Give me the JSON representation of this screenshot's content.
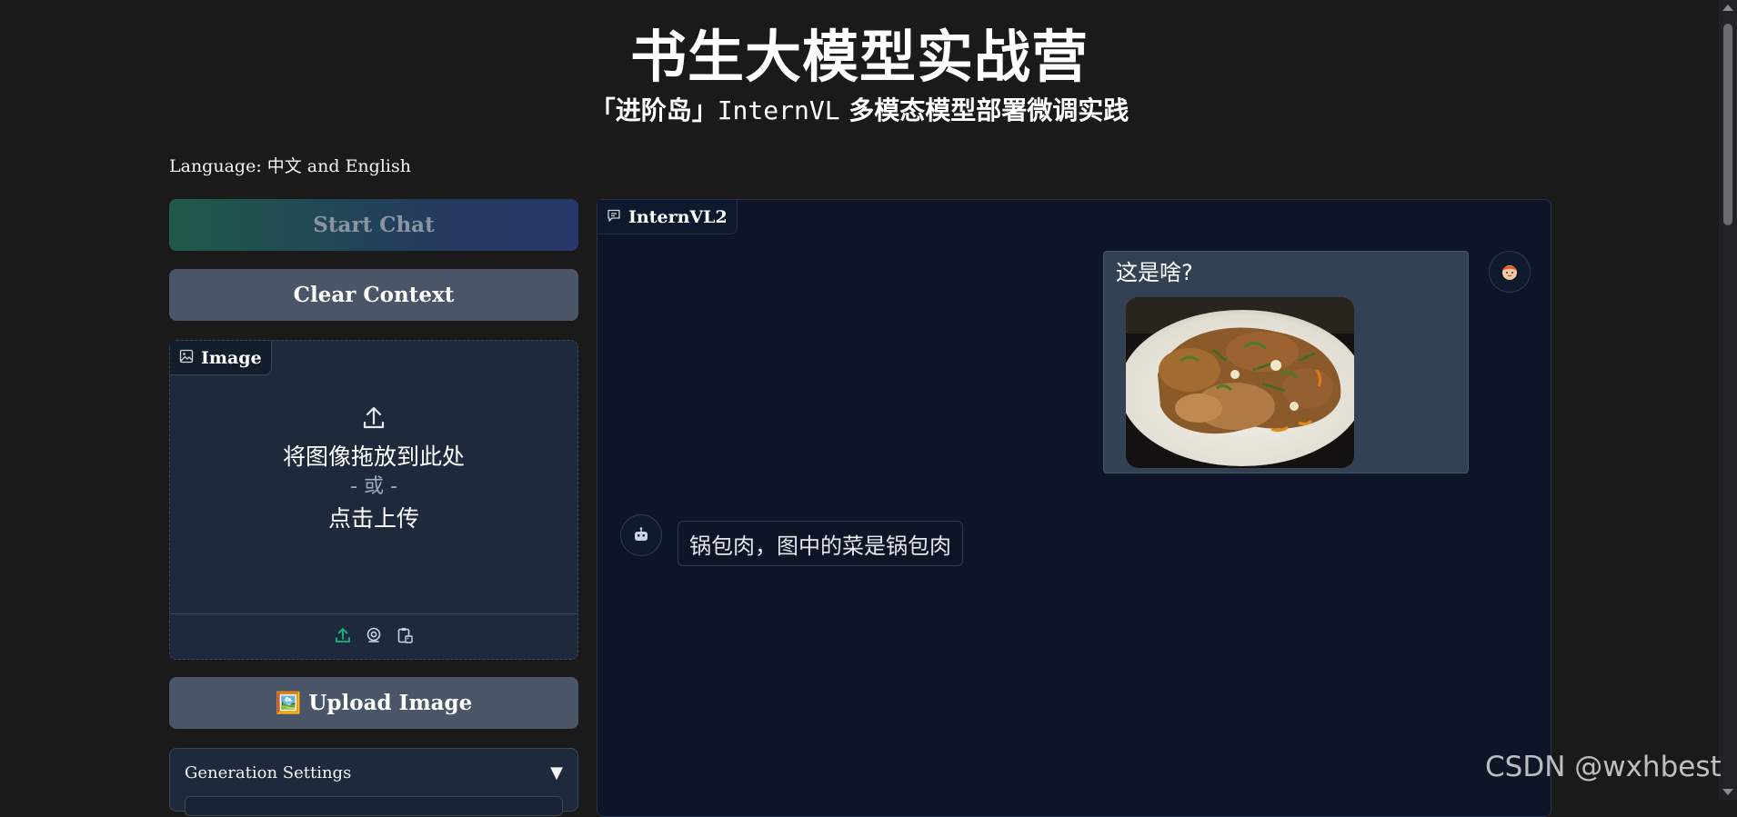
{
  "header": {
    "title": "书生大模型实战营",
    "subtitle_cn_left": "「进阶岛」",
    "subtitle_mono": "InternVL",
    "subtitle_cn_right": " 多模态模型部署微调实践"
  },
  "language_note": "Language: 中文 and English",
  "buttons": {
    "start_chat": "Start Chat",
    "clear_context": "Clear Context",
    "upload_image": "🖼️ Upload Image"
  },
  "image_panel": {
    "label": "Image",
    "drop_text": "将图像拖放到此处",
    "or_text": "- 或 -",
    "click_text": "点击上传",
    "icons": [
      "upload-icon",
      "webcam-icon",
      "clipboard-icon"
    ]
  },
  "generation_settings": {
    "label": "Generation Settings",
    "toggle_icon": "▼"
  },
  "chat": {
    "label": "InternVL2",
    "messages": [
      {
        "role": "user",
        "text": "这是啥?",
        "image": "photo of fried pork dish on white plate"
      },
      {
        "role": "assistant",
        "text": "锅包肉，图中的菜是锅包肉"
      }
    ]
  },
  "watermark": "CSDN @wxhbest",
  "colors": {
    "page_bg": "#1a1a1b",
    "panel_bg": "#1e293b",
    "chat_bg": "#0d1526",
    "button_bg": "#4b5568",
    "accent_green": "#10b981"
  }
}
